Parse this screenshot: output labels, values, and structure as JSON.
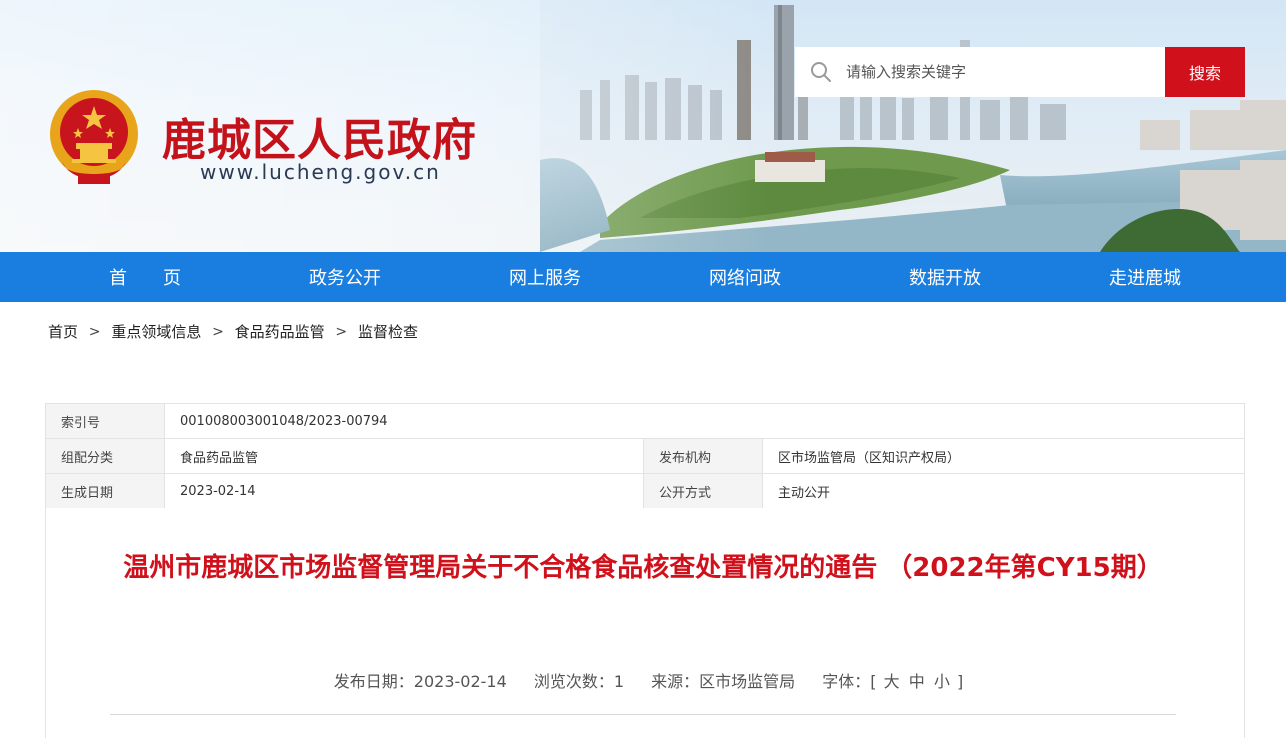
{
  "header": {
    "site_name": "鹿城区人民政府",
    "site_url": "www.lucheng.gov.cn",
    "search_placeholder": "请输入搜索关键字",
    "search_button": "搜索"
  },
  "nav": {
    "items": [
      {
        "label": "首　　页"
      },
      {
        "label": "政务公开"
      },
      {
        "label": "网上服务"
      },
      {
        "label": "网络问政"
      },
      {
        "label": "数据开放"
      },
      {
        "label": "走进鹿城"
      }
    ]
  },
  "breadcrumb": {
    "items": [
      "首页",
      "重点领域信息",
      "食品药品监管",
      "监督检查"
    ],
    "separator": ">"
  },
  "info": {
    "index_label": "索引号",
    "index_value": "001008003001048/2023-00794",
    "category_label": "组配分类",
    "category_value": "食品药品监管",
    "publisher_label": "发布机构",
    "publisher_value": "区市场监管局（区知识产权局）",
    "date_label": "生成日期",
    "date_value": "2023-02-14",
    "open_label": "公开方式",
    "open_value": "主动公开"
  },
  "article": {
    "title": "温州市鹿城区市场监督管理局关于不合格食品核查处置情况的通告 （2022年第CY15期）",
    "publish_date": "发布日期：2023-02-14",
    "views": "浏览次数：1",
    "source": "来源：区市场监管局",
    "font_label": "字体：[",
    "font_large": "大",
    "font_medium": "中",
    "font_small": "小",
    "font_close": "]"
  },
  "colors": {
    "brand_red": "#d0101b",
    "nav_blue": "#1a7ee0"
  }
}
